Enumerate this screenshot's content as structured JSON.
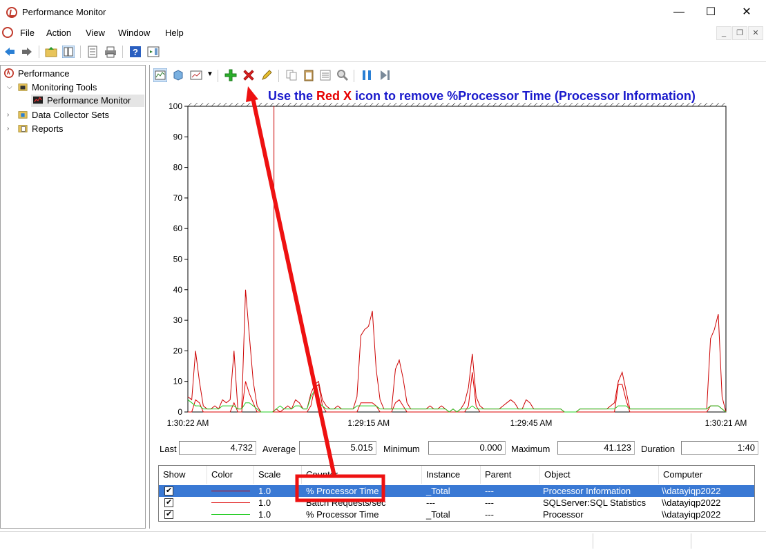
{
  "window": {
    "title": "Performance Monitor",
    "minimize": "—",
    "maximize": "☐",
    "close": "✕"
  },
  "menu": {
    "items": [
      "File",
      "Action",
      "View",
      "Window",
      "Help"
    ],
    "mdi": [
      "_",
      "❐",
      "✕"
    ]
  },
  "tree": {
    "root": "Performance",
    "monitoring_tools": "Monitoring Tools",
    "performance_monitor": "Performance Monitor",
    "data_collector_sets": "Data Collector Sets",
    "reports": "Reports"
  },
  "annotation": {
    "part1": "Use the ",
    "part2": "Red X",
    "part3": " icon to remove %Processor Time (Processor Information)",
    "color_blue": "#1a1acc",
    "color_red": "#e60000"
  },
  "stats": {
    "last_label": "Last",
    "last_value": "4.732",
    "average_label": "Average",
    "average_value": "5.015",
    "minimum_label": "Minimum",
    "minimum_value": "0.000",
    "maximum_label": "Maximum",
    "maximum_value": "41.123",
    "duration_label": "Duration",
    "duration_value": "1:40"
  },
  "legend": {
    "headers": [
      "Show",
      "Color",
      "Scale",
      "Counter",
      "Instance",
      "Parent",
      "Object",
      "Computer"
    ],
    "rows": [
      {
        "scale": "1.0",
        "counter": "% Processor Time",
        "instance": "_Total",
        "parent": "---",
        "object": "Processor Information",
        "computer": "\\\\datayiqp2022",
        "color": "#cc0000"
      },
      {
        "scale": "1.0",
        "counter": "Batch Requests/sec",
        "instance": "---",
        "parent": "---",
        "object": "SQLServer:SQL Statistics",
        "computer": "\\\\datayiqp2022",
        "color": "#dd0000"
      },
      {
        "scale": "1.0",
        "counter": "% Processor Time",
        "instance": "_Total",
        "parent": "---",
        "object": "Processor",
        "computer": "\\\\datayiqp2022",
        "color": "#22cc22"
      }
    ]
  },
  "chart_data": {
    "type": "line",
    "ylim": [
      0,
      100
    ],
    "yticks": [
      0,
      10,
      20,
      30,
      40,
      50,
      60,
      70,
      80,
      90,
      100
    ],
    "xtick_labels": [
      "1:30:22 AM",
      "1:29:15 AM",
      "1:29:45 AM",
      "1:30:21 AM"
    ],
    "current_time_marker_fraction": 0.16,
    "series": [
      {
        "color": "#cc0000",
        "values": [
          5,
          4,
          20,
          10,
          2,
          1,
          1,
          2,
          1,
          4,
          3,
          4,
          20,
          1,
          1,
          40,
          25,
          10,
          2,
          0,
          0,
          0,
          0,
          1,
          0,
          1,
          2,
          1,
          4,
          3,
          1,
          1,
          6,
          9,
          10,
          4,
          2,
          1,
          1,
          2,
          1,
          1,
          1,
          1,
          5,
          25,
          27,
          28,
          33,
          14,
          4,
          1,
          1,
          1,
          14,
          17,
          11,
          3,
          1,
          1,
          1,
          1,
          1,
          2,
          1,
          1,
          2,
          1,
          0,
          1,
          0,
          1,
          3,
          8,
          19,
          5,
          2,
          1,
          1,
          1,
          1,
          1,
          2,
          3,
          4,
          3,
          1,
          1,
          4,
          3,
          1,
          1,
          1,
          1,
          1,
          1,
          1,
          1,
          0,
          0,
          0,
          0,
          1,
          1,
          1,
          1,
          1,
          1,
          1,
          1,
          2,
          3,
          10,
          13,
          7,
          1,
          1,
          1,
          1,
          1,
          1,
          1,
          1,
          1,
          1,
          1,
          1,
          1,
          1,
          1,
          1,
          1,
          1,
          1,
          1,
          1,
          24,
          27,
          32,
          5,
          0
        ]
      },
      {
        "color": "#dd0000",
        "values": [
          0,
          0,
          4,
          3,
          0,
          0,
          0,
          0,
          0,
          0,
          0,
          0,
          3,
          0,
          0,
          10,
          6,
          3,
          0,
          0,
          0,
          0,
          0,
          0,
          0,
          0,
          0,
          0,
          0,
          0,
          0,
          0,
          2,
          8,
          9,
          2,
          0,
          0,
          0,
          0,
          0,
          0,
          0,
          0,
          0,
          3,
          3,
          3,
          3,
          2,
          0,
          0,
          0,
          0,
          3,
          4,
          2,
          0,
          0,
          0,
          0,
          0,
          0,
          0,
          0,
          0,
          0,
          0,
          0,
          0,
          0,
          0,
          0,
          2,
          13,
          2,
          0,
          0,
          0,
          0,
          0,
          0,
          0,
          0,
          0,
          0,
          0,
          0,
          0,
          0,
          0,
          0,
          0,
          0,
          0,
          0,
          0,
          0,
          0,
          0,
          0,
          0,
          0,
          0,
          0,
          0,
          0,
          0,
          0,
          0,
          0,
          0,
          9,
          9,
          4,
          0,
          0,
          0,
          0,
          0,
          0,
          0,
          0,
          0,
          0,
          0,
          0,
          0,
          0,
          0,
          0,
          0,
          0,
          0,
          0,
          0,
          2,
          2,
          2,
          1,
          0
        ]
      },
      {
        "color": "#22cc22",
        "values": [
          4,
          3,
          2,
          2,
          1,
          1,
          1,
          1,
          1,
          2,
          2,
          2,
          2,
          1,
          1,
          3,
          3,
          2,
          1,
          0,
          0,
          0,
          0,
          1,
          2,
          1,
          1,
          1,
          2,
          2,
          1,
          1,
          5,
          7,
          3,
          2,
          1,
          1,
          1,
          1,
          1,
          1,
          1,
          1,
          2,
          2,
          2,
          2,
          2,
          2,
          1,
          1,
          1,
          1,
          1,
          1,
          1,
          1,
          1,
          1,
          1,
          1,
          1,
          1,
          1,
          1,
          1,
          1,
          0,
          1,
          0,
          1,
          1,
          1,
          2,
          1,
          1,
          1,
          1,
          1,
          1,
          1,
          1,
          1,
          1,
          1,
          1,
          1,
          1,
          1,
          1,
          1,
          1,
          1,
          1,
          1,
          1,
          1,
          0,
          0,
          0,
          0,
          1,
          1,
          1,
          1,
          1,
          1,
          1,
          1,
          1,
          1,
          2,
          2,
          2,
          1,
          1,
          1,
          1,
          1,
          1,
          1,
          1,
          1,
          1,
          1,
          1,
          1,
          1,
          1,
          1,
          1,
          1,
          1,
          1,
          1,
          2,
          2,
          2,
          1,
          0
        ]
      }
    ]
  }
}
